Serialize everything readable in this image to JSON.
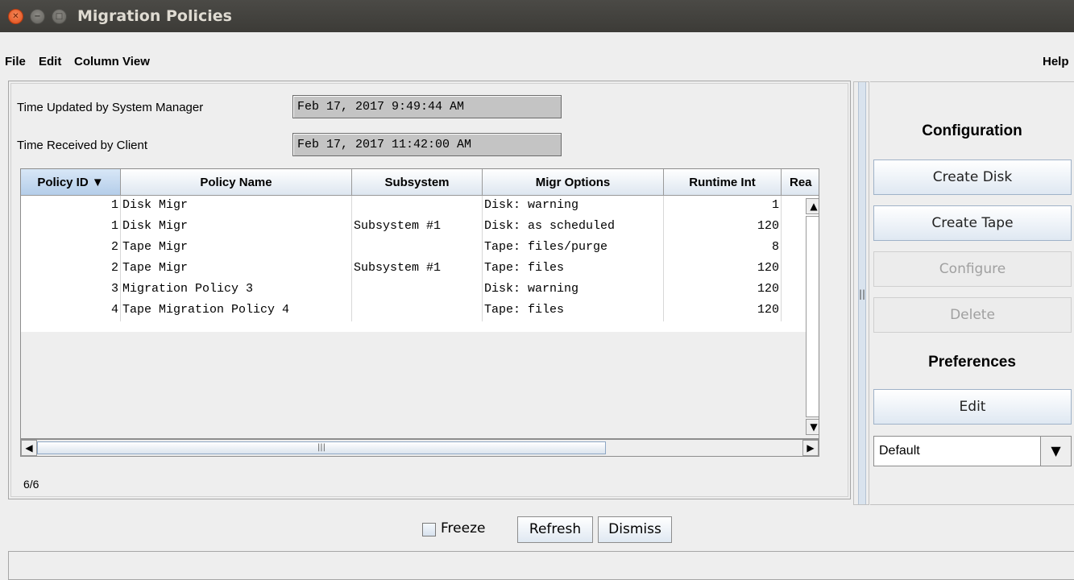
{
  "window": {
    "title": "Migration Policies"
  },
  "menus": {
    "file": "File",
    "edit": "Edit",
    "column_view": "Column View",
    "help": "Help"
  },
  "times": {
    "updated_label": "Time Updated by System Manager",
    "updated_value": "Feb 17, 2017 9:49:44 AM",
    "received_label": "Time Received by Client",
    "received_value": "Feb 17, 2017 11:42:00 AM"
  },
  "table": {
    "columns": [
      "Policy ID ▼",
      "Policy Name",
      "Subsystem",
      "Migr Options",
      "Runtime Int",
      "Rea"
    ],
    "rows": [
      [
        "1",
        "Disk Migr",
        "",
        "Disk: warning",
        "1"
      ],
      [
        "1",
        "Disk Migr",
        "Subsystem #1",
        "Disk: as scheduled",
        "120"
      ],
      [
        "2",
        "Tape Migr",
        "",
        "Tape: files/purge",
        "8"
      ],
      [
        "2",
        "Tape Migr",
        "Subsystem #1",
        "Tape: files",
        "120"
      ],
      [
        "3",
        "Migration Policy 3",
        "",
        "Disk: warning",
        "120"
      ],
      [
        "4",
        "Tape Migration Policy 4",
        "",
        "Tape: files",
        "120"
      ]
    ],
    "count": "6/6"
  },
  "sidebar": {
    "configuration_heading": "Configuration",
    "create_disk": "Create Disk",
    "create_tape": "Create Tape",
    "configure": "Configure",
    "delete": "Delete",
    "preferences_heading": "Preferences",
    "edit": "Edit",
    "preference_value": "Default"
  },
  "footer": {
    "freeze": "Freeze",
    "refresh": "Refresh",
    "dismiss": "Dismiss"
  },
  "colors": {
    "titlebar": "#3c3b37",
    "close_button": "#df4a16",
    "header_sorted": "#b4cde9"
  }
}
